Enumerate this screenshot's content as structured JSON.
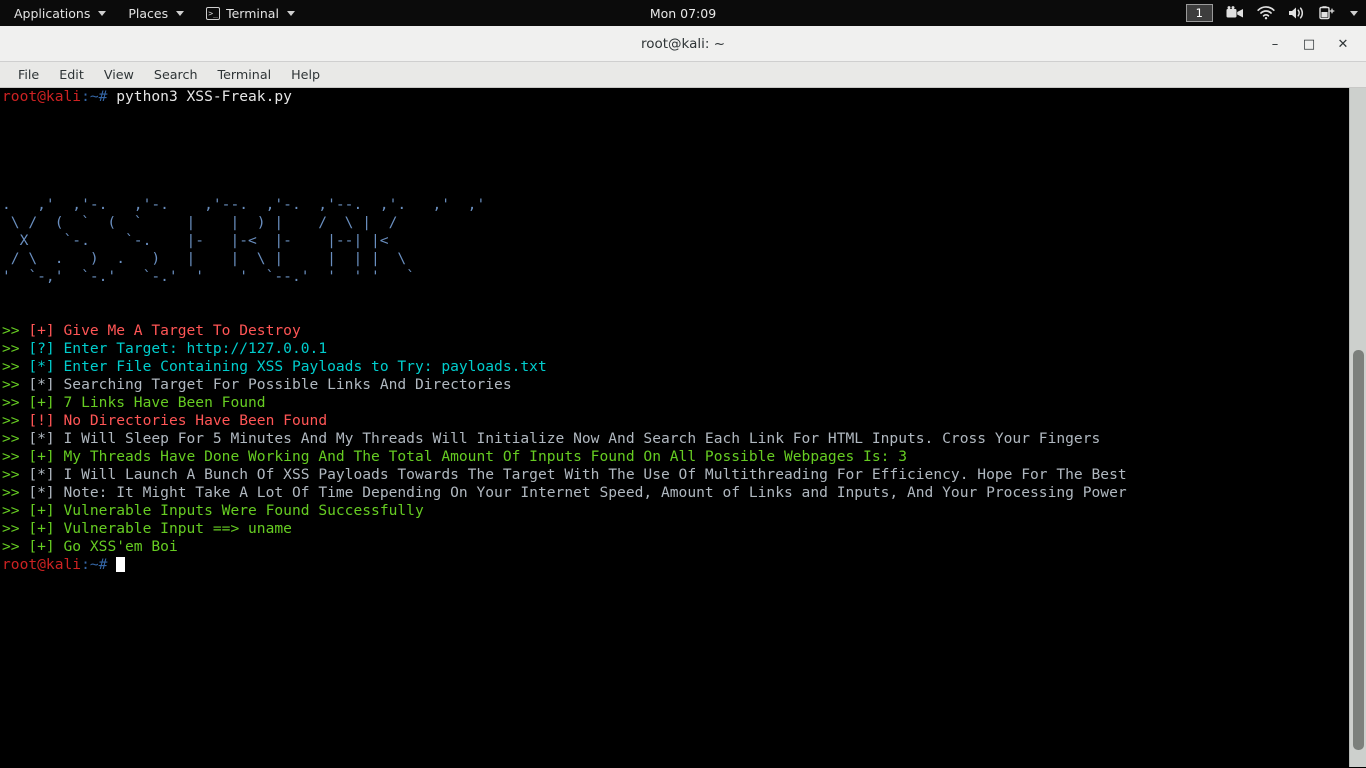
{
  "panel": {
    "menus": [
      {
        "label": "Applications",
        "icon": null,
        "caret": true
      },
      {
        "label": "Places",
        "icon": null,
        "caret": true
      },
      {
        "label": "Terminal",
        "icon": "terminal-icon",
        "caret": true
      }
    ],
    "clock": "Mon 07:09",
    "tray": {
      "workspace": "1",
      "icons": [
        "screencast-icon",
        "wifi-icon",
        "volume-icon",
        "battery-icon",
        "chevron-down-icon"
      ]
    }
  },
  "window": {
    "title": "root@kali: ~",
    "buttons": {
      "minimize": "–",
      "maximize": "□",
      "close": "✕"
    },
    "menubar": [
      "File",
      "Edit",
      "View",
      "Search",
      "Terminal",
      "Help"
    ]
  },
  "terminal": {
    "prompt_user": "root@kali",
    "prompt_path": ":~#",
    "command": " python3 XSS-Freak.py",
    "banner": [
      " .      ,'   ,'-.     ,'-.         ,'--.    ,'-.    ,'--.    ,'.     ,'  ,'",
      "  \\  /  (  `  (  `     |    |  ) |    /  \\ |  /",
      "   X     `-.    `-.    |-   |-<  |-    |--| |<",
      "  / \\   .   )  .   )   |    |  \\ |     |  | |  \\",
      " '   `-,'  `-.'    '    '    '  `--.'  '  ' '   `"
    ],
    "banner_art": [
      ".   ,'  ,'-.   ,'-.    ,'--.  ,'-.  ,'--.  ,'.   ,'  ,'",
      " \\ /  (  `  (  `     |    |  ) |    /  \\ |  /",
      "  X    `-.    `-.    |-   |-<  |-    |--| |<",
      " / \\  .   )  .   )   |    |  \\ |     |  | |  \\",
      "'  `-,'  `-.'   `-.'  '    '  `--.'  '  ' '   `"
    ],
    "lines": [
      {
        "marker": ">> ",
        "tag": "[+] ",
        "tag_color": "red",
        "text": "Give Me A Target To Destroy",
        "text_color": "red"
      },
      {
        "marker": ">> ",
        "tag": "[?] ",
        "tag_color": "cyan",
        "text": "Enter Target: http://127.0.0.1",
        "text_color": "cyan"
      },
      {
        "marker": ">> ",
        "tag": "[*] ",
        "tag_color": "cyan",
        "text": "Enter File Containing XSS Payloads to Try: payloads.txt",
        "text_color": "cyan"
      },
      {
        "marker": ">> ",
        "tag": "[*] ",
        "tag_color": "gray",
        "text": "Searching Target For Possible Links And Directories",
        "text_color": "gray"
      },
      {
        "marker": ">> ",
        "tag": "[+] ",
        "tag_color": "green",
        "text": "7 Links Have Been Found",
        "text_color": "green"
      },
      {
        "marker": ">> ",
        "tag": "[!] ",
        "tag_color": "red",
        "text": "No Directories Have Been Found",
        "text_color": "red"
      },
      {
        "marker": ">> ",
        "tag": "[*] ",
        "tag_color": "gray",
        "text": "I Will Sleep For 5 Minutes And My Threads Will Initialize Now And Search Each Link For HTML Inputs. Cross Your Fingers",
        "text_color": "gray"
      },
      {
        "marker": ">> ",
        "tag": "[+] ",
        "tag_color": "green",
        "text": "My Threads Have Done Working And The Total Amount Of Inputs Found On All Possible Webpages Is: 3",
        "text_color": "green"
      },
      {
        "marker": ">> ",
        "tag": "[*] ",
        "tag_color": "gray",
        "text": "I Will Launch A Bunch Of XSS Payloads Towards The Target With The Use Of Multithreading For Efficiency. Hope For The Best",
        "text_color": "gray"
      },
      {
        "marker": ">> ",
        "tag": "[*] ",
        "tag_color": "gray",
        "text": "Note: It Might Take A Lot Of Time Depending On Your Internet Speed, Amount of Links and Inputs, And Your Processing Power",
        "text_color": "gray"
      },
      {
        "marker": ">> ",
        "tag": "[+] ",
        "tag_color": "green",
        "text": "Vulnerable Inputs Were Found Successfully",
        "text_color": "green"
      },
      {
        "marker": ">> ",
        "tag": "[+] ",
        "tag_color": "green",
        "text": "Vulnerable Input ==> uname",
        "text_color": "green"
      },
      {
        "marker": ">> ",
        "tag": "[+] ",
        "tag_color": "green",
        "text": "Go XSS'em Boi",
        "text_color": "green"
      }
    ],
    "final_prompt_user": "root@kali",
    "final_prompt_path": ":~#",
    "cursor": "block"
  },
  "colors": {
    "terminal_bg": "#000000",
    "red": "#ff5555",
    "green": "#66cc22",
    "cyan": "#00cdcd",
    "gray": "#b0b8c0",
    "banner_blue": "#6a8fc0",
    "prompt_red": "#cc2222",
    "titlebar_bg": "#f0f0ef",
    "panel_bg": "#0b0b0b"
  }
}
